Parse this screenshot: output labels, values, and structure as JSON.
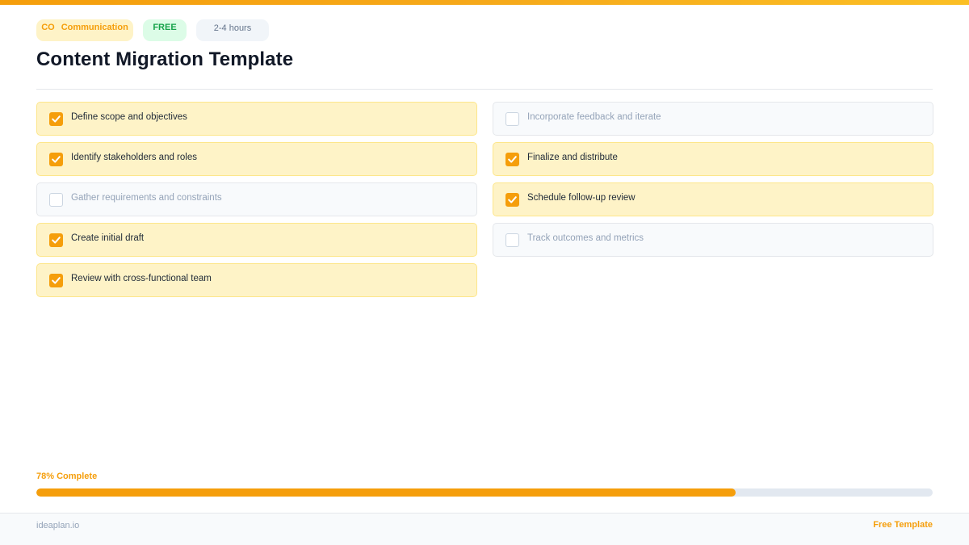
{
  "badges": {
    "category_code": "CO",
    "category": "Communication",
    "price": "FREE",
    "duration": "2-4 hours"
  },
  "title": "Content Migration Template",
  "checklist": {
    "left": [
      {
        "label": "Define scope and objectives",
        "checked": true
      },
      {
        "label": "Identify stakeholders and roles",
        "checked": true
      },
      {
        "label": "Gather requirements and constraints",
        "checked": false
      },
      {
        "label": "Create initial draft",
        "checked": true
      },
      {
        "label": "Review with cross-functional team",
        "checked": true
      }
    ],
    "right": [
      {
        "label": "Incorporate feedback and iterate",
        "checked": false
      },
      {
        "label": "Finalize and distribute",
        "checked": true
      },
      {
        "label": "Schedule follow-up review",
        "checked": true
      },
      {
        "label": "Track outcomes and metrics",
        "checked": false
      }
    ]
  },
  "progress": {
    "label": "78% Complete",
    "percent": 78
  },
  "footer": {
    "brand": "ideaplan.io",
    "tag": "Free Template"
  },
  "colors": {
    "accent": "#f59e0b",
    "done_bg": "#fef3c7",
    "todo_bg": "#f8fafc",
    "free_badge": "#16a34a"
  },
  "icons": {
    "checked": "checkmark-icon"
  }
}
